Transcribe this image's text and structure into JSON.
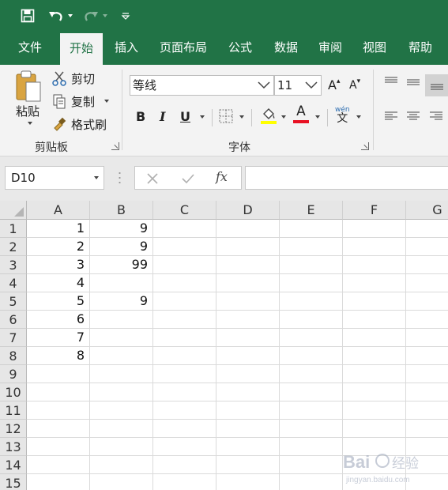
{
  "quick_access": {
    "save_icon": "save-icon",
    "undo_icon": "undo-icon",
    "redo_icon": "redo-icon",
    "customize_icon": "customize-qat-icon"
  },
  "ribbon_tabs": [
    "文件",
    "开始",
    "插入",
    "页面布局",
    "公式",
    "数据",
    "审阅",
    "视图",
    "帮助"
  ],
  "active_tab": "开始",
  "clipboard": {
    "paste_label": "粘贴",
    "cut_label": "剪切",
    "copy_label": "复制",
    "format_painter_label": "格式刷",
    "group_label": "剪贴板"
  },
  "font": {
    "font_name": "等线",
    "font_size": "11",
    "bold": "B",
    "italic": "I",
    "underline": "U",
    "font_color_letter": "A",
    "phonetic_top": "wén",
    "phonetic_bottom": "文",
    "group_label": "字体",
    "grow_font": "A",
    "shrink_font": "A"
  },
  "formula_bar": {
    "name_box": "D10",
    "fx_label": "fx",
    "formula": ""
  },
  "sheet": {
    "columns": [
      "A",
      "B",
      "C",
      "D",
      "E",
      "F",
      "G"
    ],
    "rows": [
      "1",
      "2",
      "3",
      "4",
      "5",
      "6",
      "7",
      "8",
      "9",
      "10",
      "11",
      "12",
      "13",
      "14",
      "15"
    ],
    "cells": {
      "A": [
        "1",
        "2",
        "3",
        "4",
        "5",
        "6",
        "7",
        "8",
        "",
        "",
        "",
        "",
        "",
        "",
        ""
      ],
      "B": [
        "9",
        "9",
        "99",
        "",
        "9",
        "",
        "",
        "",
        "",
        "",
        "",
        "",
        "",
        "",
        ""
      ]
    }
  },
  "watermark": {
    "brand": "Bai",
    "brand_suffix": "经验",
    "url": "jingyan.baidu.com"
  },
  "colors": {
    "brand_green": "#217346",
    "ribbon_bg": "#f3f3f3",
    "header_bg": "#e6e6e6",
    "highlight_yellow": "#ffff00",
    "font_red": "#e81123"
  }
}
